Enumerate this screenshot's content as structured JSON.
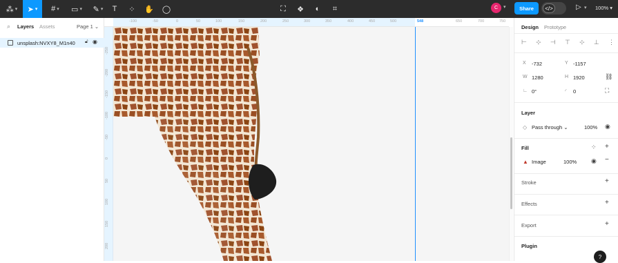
{
  "toolbar": {
    "share_label": "Share",
    "avatar_initial": "C",
    "zoom_label": "100%",
    "dev_mode_symbol": "</>"
  },
  "left_panel": {
    "tabs": [
      "Layers",
      "Assets"
    ],
    "page_selector": "Page 1",
    "layers": [
      {
        "name": "unsplash:NVXY8_M1n40"
      }
    ]
  },
  "ruler": {
    "top_ticks": [
      "-100",
      "-50",
      "0",
      "50",
      "100",
      "150",
      "200",
      "250",
      "300",
      "350",
      "400",
      "450",
      "500",
      "548",
      "650",
      "700",
      "750"
    ],
    "highlight_tick": "548",
    "left_ticks": [
      "-250",
      "-200",
      "-150",
      "-100",
      "-50",
      "0",
      "50",
      "100",
      "150",
      "200",
      "250"
    ]
  },
  "right_panel": {
    "tabs": [
      "Design",
      "Prototype"
    ],
    "x_label": "X",
    "x_value": "-732",
    "y_label": "Y",
    "y_value": "-1157",
    "w_label": "W",
    "w_value": "1280",
    "h_label": "H",
    "h_value": "1920",
    "rotation_value": "0°",
    "radius_value": "0",
    "layer_title": "Layer",
    "blend_mode": "Pass through",
    "layer_opacity": "100%",
    "fill_title": "Fill",
    "fill_type": "Image",
    "fill_opacity": "100%",
    "stroke_title": "Stroke",
    "effects_title": "Effects",
    "export_title": "Export",
    "plugin_title": "Plugin",
    "help_symbol": "?"
  },
  "colors": {
    "accent": "#0d99ff",
    "toolbar_bg": "#2c2c2c",
    "avatar": "#e5266e",
    "guide": "#1e90ff"
  }
}
